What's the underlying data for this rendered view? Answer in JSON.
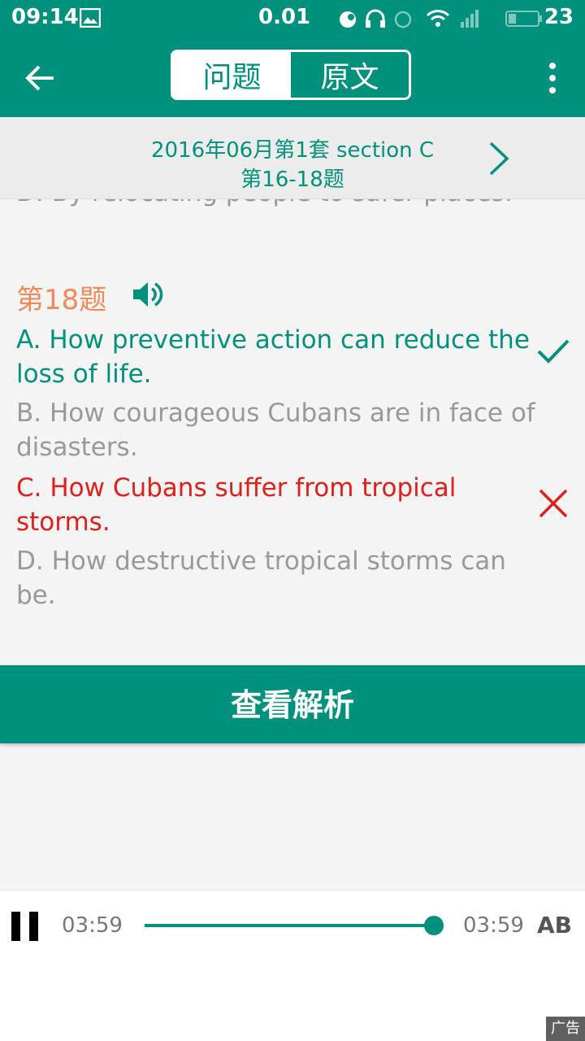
{
  "status_bar": {
    "time": "09:14",
    "speed": "0.01",
    "battery": "23"
  },
  "app_bar": {
    "tabs": [
      {
        "label": "问题",
        "active": false
      },
      {
        "label": "原文",
        "active": true
      }
    ],
    "accent_color": "#00917c"
  },
  "subheader": {
    "line1": "2016年06月第1套 section C",
    "line2": "第16-18题"
  },
  "content": {
    "previous_option": "D. By relocating people to safer places.",
    "question_title": "第18题",
    "options": [
      {
        "text": "A. How preventive action can reduce the loss of life.",
        "state": "correct"
      },
      {
        "text": "B. How courageous Cubans are in face of disasters.",
        "state": "neutral"
      },
      {
        "text": "C. How Cubans suffer from tropical storms.",
        "state": "wrong"
      },
      {
        "text": "D. How destructive tropical storms can be.",
        "state": "neutral"
      }
    ],
    "colors": {
      "correct": "#00917c",
      "wrong": "#e0201a",
      "neutral": "#999999",
      "title": "#f08a5d"
    }
  },
  "analysis_button": {
    "label": "查看解析"
  },
  "player": {
    "current_time": "03:59",
    "total_time": "03:59",
    "ab_label": "AB",
    "progress": 1.0
  },
  "ad": {
    "label": "广告"
  }
}
